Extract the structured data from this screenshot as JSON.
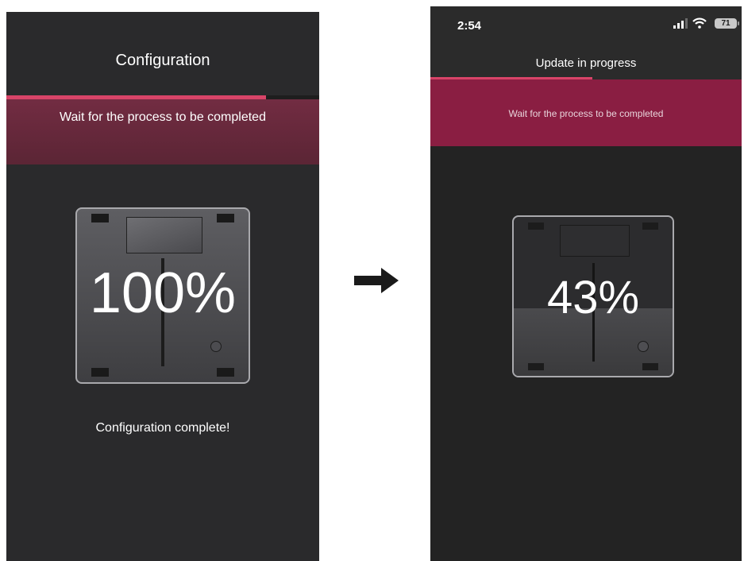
{
  "left_screen": {
    "title": "Configuration",
    "progress_fraction": 0.83,
    "banner_text": "Wait for the process to be completed",
    "percent_text": "100%",
    "status_text": "Configuration complete!"
  },
  "right_screen": {
    "status_bar": {
      "time": "2:54",
      "battery": "71"
    },
    "title": "Update in progress",
    "progress_fraction": 0.52,
    "banner_text": "Wait for the process to be completed",
    "percent_text": "43%"
  },
  "icons": {
    "arrow": "arrow-right-icon",
    "signal": "cellular-signal-icon",
    "wifi": "wifi-icon",
    "battery": "battery-icon"
  },
  "colors": {
    "accent": "#d84468",
    "left_banner": "#722c42",
    "right_banner": "#8a1e42",
    "background_dark": "#2a2a2c"
  }
}
